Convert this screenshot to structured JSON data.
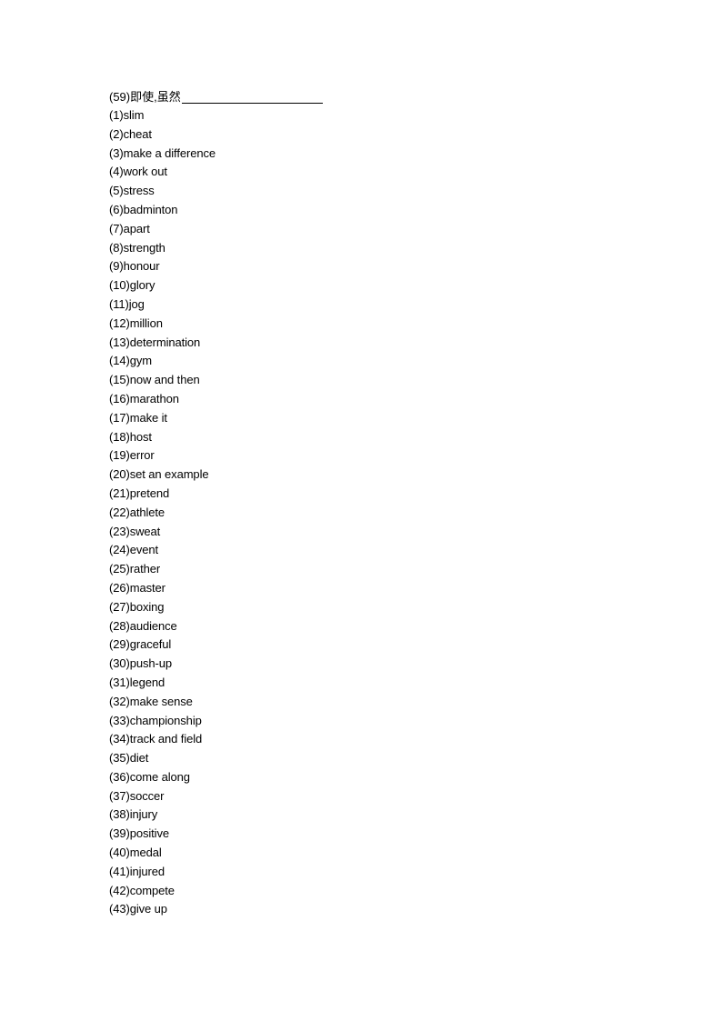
{
  "question": {
    "number": "(59)",
    "prompt": "即使,虽然",
    "answer_blank": ""
  },
  "answers": [
    {
      "number": "(1)",
      "text": "slim"
    },
    {
      "number": "(2)",
      "text": "cheat"
    },
    {
      "number": "(3)",
      "text": "make a difference"
    },
    {
      "number": "(4)",
      "text": "work out"
    },
    {
      "number": "(5)",
      "text": "stress"
    },
    {
      "number": "(6)",
      "text": "badminton"
    },
    {
      "number": "(7)",
      "text": "apart"
    },
    {
      "number": "(8)",
      "text": "strength"
    },
    {
      "number": "(9)",
      "text": "honour"
    },
    {
      "number": "(10)",
      "text": "glory"
    },
    {
      "number": "(11)",
      "text": "jog"
    },
    {
      "number": "(12)",
      "text": "million"
    },
    {
      "number": "(13)",
      "text": "determination"
    },
    {
      "number": "(14)",
      "text": "gym"
    },
    {
      "number": "(15)",
      "text": "now and then"
    },
    {
      "number": "(16)",
      "text": "marathon"
    },
    {
      "number": "(17)",
      "text": "make it"
    },
    {
      "number": "(18)",
      "text": "host"
    },
    {
      "number": "(19)",
      "text": "error"
    },
    {
      "number": "(20)",
      "text": "set an example"
    },
    {
      "number": "(21)",
      "text": "pretend"
    },
    {
      "number": "(22)",
      "text": "athlete"
    },
    {
      "number": "(23)",
      "text": "sweat"
    },
    {
      "number": "(24)",
      "text": "event"
    },
    {
      "number": "(25)",
      "text": "rather"
    },
    {
      "number": "(26)",
      "text": "master"
    },
    {
      "number": "(27)",
      "text": "boxing"
    },
    {
      "number": "(28)",
      "text": "audience"
    },
    {
      "number": "(29)",
      "text": "graceful"
    },
    {
      "number": "(30)",
      "text": "push-up"
    },
    {
      "number": "(31)",
      "text": "legend"
    },
    {
      "number": "(32)",
      "text": "make sense"
    },
    {
      "number": "(33)",
      "text": "championship"
    },
    {
      "number": "(34)",
      "text": "track and field"
    },
    {
      "number": "(35)",
      "text": "diet"
    },
    {
      "number": "(36)",
      "text": "come along"
    },
    {
      "number": "(37)",
      "text": "soccer"
    },
    {
      "number": "(38)",
      "text": "injury"
    },
    {
      "number": "(39)",
      "text": "positive"
    },
    {
      "number": "(40)",
      "text": "medal"
    },
    {
      "number": "(41)",
      "text": "injured"
    },
    {
      "number": "(42)",
      "text": "compete"
    },
    {
      "number": "(43)",
      "text": "give up"
    }
  ]
}
